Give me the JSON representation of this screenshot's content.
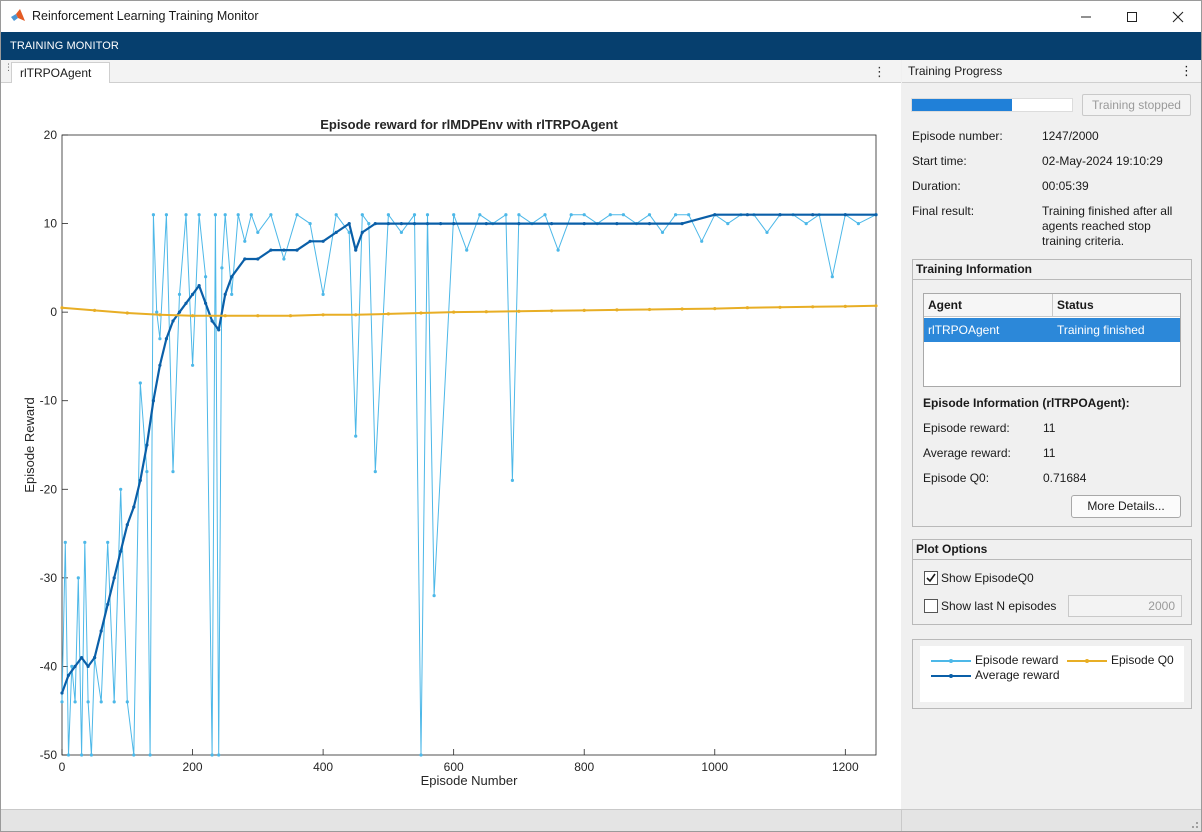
{
  "window": {
    "title": "Reinforcement Learning Training Monitor"
  },
  "ribbon": {
    "tab": "TRAINING MONITOR"
  },
  "document_tab": {
    "label": "rlTRPOAgent"
  },
  "right_panel": {
    "header": "Training Progress",
    "progress_fraction": 0.6235,
    "stop_button": "Training stopped",
    "rows": [
      {
        "label": "Episode number:",
        "value": "1247/2000"
      },
      {
        "label": "Start time:",
        "value": "02-May-2024 19:10:29"
      },
      {
        "label": "Duration:",
        "value": "00:05:39"
      },
      {
        "label": "Final result:",
        "value": "Training finished after all agents reached stop training criteria."
      }
    ],
    "training_info": {
      "title": "Training Information",
      "columns": [
        "Agent",
        "Status"
      ],
      "rows": [
        {
          "agent": "rlTRPOAgent",
          "status": "Training finished"
        }
      ],
      "episode_info_title": "Episode Information (rlTRPOAgent):",
      "episode_rows": [
        {
          "label": "Episode reward:",
          "value": "11"
        },
        {
          "label": "Average reward:",
          "value": "11"
        },
        {
          "label": "Episode Q0:",
          "value": "0.71684"
        }
      ],
      "more_details": "More Details..."
    },
    "plot_options": {
      "title": "Plot Options",
      "show_q0": {
        "label": "Show EpisodeQ0",
        "checked": true
      },
      "show_last_n": {
        "label": "Show last N episodes",
        "checked": false,
        "value": "2000"
      }
    },
    "legend": {
      "episode_reward": "Episode reward",
      "episode_q0": "Episode Q0",
      "average_reward": "Average reward"
    }
  },
  "colors": {
    "episode_reward": "#4db8e8",
    "average_reward": "#0a5fa8",
    "episode_q0": "#e8ae25",
    "ribbon": "#063f6e",
    "selection": "#2c88d9"
  },
  "chart_data": {
    "type": "line",
    "title": "Episode reward for rlMDPEnv with rlTRPOAgent",
    "xlabel": "Episode Number",
    "ylabel": "Episode Reward",
    "xlim": [
      0,
      1247
    ],
    "ylim": [
      -50,
      20
    ],
    "xticks": [
      0,
      200,
      400,
      600,
      800,
      1000,
      1200
    ],
    "yticks": [
      -50,
      -40,
      -30,
      -20,
      -10,
      0,
      10,
      20
    ],
    "grid": false,
    "series": [
      {
        "name": "Episode reward",
        "description": "noisy per-episode reward; jumps between roughly -50 and 11, concentrating near 11 after about episode 300",
        "x": [
          0,
          5,
          10,
          15,
          20,
          25,
          30,
          35,
          40,
          45,
          50,
          60,
          70,
          80,
          90,
          100,
          110,
          120,
          130,
          135,
          140,
          145,
          150,
          160,
          170,
          180,
          190,
          200,
          210,
          220,
          230,
          235,
          240,
          245,
          250,
          260,
          270,
          280,
          290,
          300,
          320,
          340,
          360,
          380,
          400,
          420,
          440,
          450,
          460,
          470,
          480,
          500,
          520,
          540,
          550,
          560,
          570,
          600,
          620,
          640,
          660,
          680,
          690,
          700,
          720,
          740,
          760,
          780,
          800,
          820,
          840,
          860,
          880,
          900,
          920,
          940,
          960,
          980,
          1000,
          1020,
          1040,
          1060,
          1080,
          1100,
          1120,
          1140,
          1160,
          1180,
          1200,
          1220,
          1247
        ],
        "values": [
          -44,
          -26,
          -50,
          -40,
          -44,
          -30,
          -50,
          -26,
          -44,
          -50,
          -39,
          -44,
          -26,
          -44,
          -20,
          -44,
          -50,
          -8,
          -18,
          -50,
          11,
          0,
          -3,
          11,
          -18,
          2,
          11,
          -6,
          11,
          4,
          -50,
          11,
          -50,
          5,
          11,
          2,
          11,
          8,
          11,
          9,
          11,
          6,
          11,
          10,
          2,
          11,
          9,
          -14,
          11,
          10,
          -18,
          11,
          9,
          11,
          -50,
          11,
          -32,
          11,
          7,
          11,
          10,
          11,
          -19,
          11,
          10,
          11,
          7,
          11,
          11,
          10,
          11,
          11,
          10,
          11,
          9,
          11,
          11,
          8,
          11,
          10,
          11,
          11,
          9,
          11,
          11,
          10,
          11,
          4,
          11,
          10,
          11
        ]
      },
      {
        "name": "Average reward",
        "x": [
          0,
          10,
          20,
          30,
          40,
          50,
          60,
          70,
          80,
          90,
          100,
          110,
          120,
          130,
          140,
          150,
          160,
          170,
          180,
          190,
          200,
          210,
          220,
          230,
          240,
          250,
          260,
          280,
          300,
          320,
          340,
          360,
          380,
          400,
          420,
          440,
          450,
          460,
          480,
          500,
          520,
          540,
          560,
          580,
          600,
          650,
          700,
          750,
          800,
          850,
          900,
          950,
          1000,
          1050,
          1100,
          1150,
          1200,
          1247
        ],
        "values": [
          -43,
          -41,
          -40,
          -39,
          -40,
          -39,
          -36,
          -33,
          -30,
          -27,
          -24,
          -22,
          -19,
          -15,
          -10,
          -6,
          -3,
          -1,
          0,
          1,
          2,
          3,
          1,
          -1,
          -2,
          2,
          4,
          6,
          6,
          7,
          7,
          7,
          8,
          8,
          9,
          10,
          7,
          9,
          10,
          10,
          10,
          10,
          10,
          10,
          10,
          10,
          10,
          10,
          10,
          10,
          10,
          10,
          11,
          11,
          11,
          11,
          11,
          11
        ]
      },
      {
        "name": "Episode Q0",
        "x": [
          0,
          50,
          100,
          150,
          200,
          250,
          300,
          350,
          400,
          450,
          500,
          550,
          600,
          650,
          700,
          750,
          800,
          850,
          900,
          950,
          1000,
          1050,
          1100,
          1150,
          1200,
          1247
        ],
        "values": [
          0.5,
          0.2,
          -0.1,
          -0.3,
          -0.4,
          -0.4,
          -0.4,
          -0.4,
          -0.3,
          -0.3,
          -0.2,
          -0.1,
          0.0,
          0.05,
          0.1,
          0.15,
          0.2,
          0.25,
          0.3,
          0.35,
          0.4,
          0.5,
          0.55,
          0.6,
          0.65,
          0.72
        ]
      }
    ]
  }
}
